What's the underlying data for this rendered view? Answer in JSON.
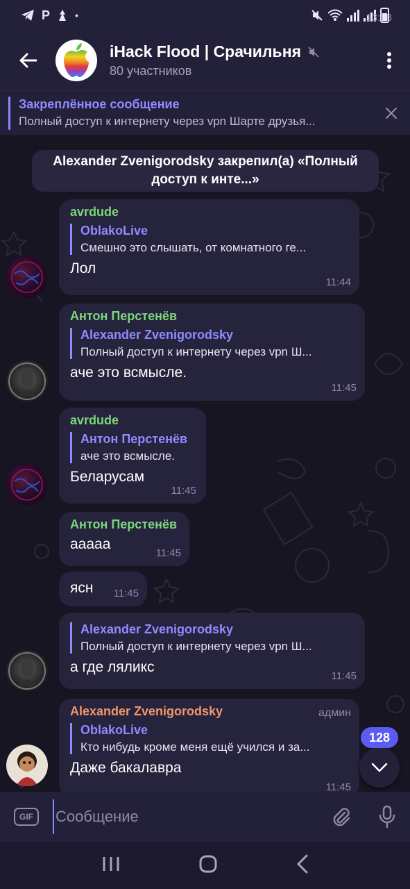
{
  "status_bar": {
    "time": "13:18",
    "notif_p": "P"
  },
  "header": {
    "title": "iHack Flood | Срачильня",
    "subtitle": "80 участников"
  },
  "pinned": {
    "title": "Закреплённое сообщение",
    "text": "Полный доступ к интернету через vpn Шарте друзья..."
  },
  "service_message": "Alexander Zvenigorodsky закрепил(а) «Полный доступ к инте...»",
  "colors": {
    "accent": "#8f8bff",
    "sender_green": "#7bd67b",
    "sender_orange": "#f0976a",
    "bubble": "#26233d",
    "badge": "#5b5bf2"
  },
  "messages": [
    {
      "sender": "avrdude",
      "reply_name": "OblakoLive",
      "reply_text": "Смешно это слышать, от комнатного ге...",
      "text": "Лол",
      "time": "11:44"
    },
    {
      "sender": "Антон Перстенёв",
      "reply_name": "Alexander Zvenigorodsky",
      "reply_text": "Полный доступ к интернету через vpn Ш...",
      "text": "аче это всмысле.",
      "time": "11:45"
    },
    {
      "sender": "avrdude",
      "reply_name": "Антон Перстенёв",
      "reply_text": "аче это всмысле.",
      "text": "Беларусам",
      "time": "11:45"
    },
    {
      "sender": "Антон Перстенёв",
      "text": "ааааа",
      "time": "11:45"
    },
    {
      "text": "ясн",
      "time": "11:45"
    },
    {
      "reply_name": "Alexander Zvenigorodsky",
      "reply_text": "Полный доступ к интернету через vpn Ш...",
      "text": "а где ляликс",
      "time": "11:45"
    },
    {
      "sender": "Alexander Zvenigorodsky",
      "role": "админ",
      "reply_name": "OblakoLive",
      "reply_text": "Кто нибудь кроме меня ещё учился и за...",
      "text": "Даже бакалавра",
      "time": "11:45"
    }
  ],
  "unread_badge": "128",
  "input": {
    "gif_label": "GIF",
    "placeholder": "Сообщение"
  },
  "icons": [
    "back-arrow-icon",
    "mute-icon",
    "more-vertical-icon",
    "close-icon",
    "attach-icon",
    "mic-icon",
    "chevron-down-icon",
    "nav-recents-icon",
    "nav-home-icon",
    "nav-back-icon"
  ]
}
